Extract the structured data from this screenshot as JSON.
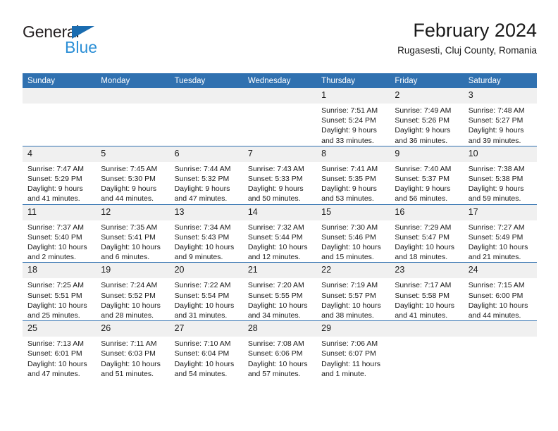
{
  "brand": {
    "name_dark": "General",
    "name_light": "Blue",
    "triangle_icon": "brand-triangle-icon"
  },
  "header": {
    "title": "February 2024",
    "location": "Rugasesti, Cluj County, Romania"
  },
  "colors": {
    "header_blue": "#3071B0",
    "brand_blue": "#2C8FD6",
    "daynum_band": "#F0F0F0",
    "text": "#1A1A1A"
  },
  "weekday_headers": [
    "Sunday",
    "Monday",
    "Tuesday",
    "Wednesday",
    "Thursday",
    "Friday",
    "Saturday"
  ],
  "weeks": [
    [
      {
        "day": "",
        "lines": []
      },
      {
        "day": "",
        "lines": []
      },
      {
        "day": "",
        "lines": []
      },
      {
        "day": "",
        "lines": []
      },
      {
        "day": "1",
        "lines": [
          "Sunrise: 7:51 AM",
          "Sunset: 5:24 PM",
          "Daylight: 9 hours",
          "and 33 minutes."
        ]
      },
      {
        "day": "2",
        "lines": [
          "Sunrise: 7:49 AM",
          "Sunset: 5:26 PM",
          "Daylight: 9 hours",
          "and 36 minutes."
        ]
      },
      {
        "day": "3",
        "lines": [
          "Sunrise: 7:48 AM",
          "Sunset: 5:27 PM",
          "Daylight: 9 hours",
          "and 39 minutes."
        ]
      }
    ],
    [
      {
        "day": "4",
        "lines": [
          "Sunrise: 7:47 AM",
          "Sunset: 5:29 PM",
          "Daylight: 9 hours",
          "and 41 minutes."
        ]
      },
      {
        "day": "5",
        "lines": [
          "Sunrise: 7:45 AM",
          "Sunset: 5:30 PM",
          "Daylight: 9 hours",
          "and 44 minutes."
        ]
      },
      {
        "day": "6",
        "lines": [
          "Sunrise: 7:44 AM",
          "Sunset: 5:32 PM",
          "Daylight: 9 hours",
          "and 47 minutes."
        ]
      },
      {
        "day": "7",
        "lines": [
          "Sunrise: 7:43 AM",
          "Sunset: 5:33 PM",
          "Daylight: 9 hours",
          "and 50 minutes."
        ]
      },
      {
        "day": "8",
        "lines": [
          "Sunrise: 7:41 AM",
          "Sunset: 5:35 PM",
          "Daylight: 9 hours",
          "and 53 minutes."
        ]
      },
      {
        "day": "9",
        "lines": [
          "Sunrise: 7:40 AM",
          "Sunset: 5:37 PM",
          "Daylight: 9 hours",
          "and 56 minutes."
        ]
      },
      {
        "day": "10",
        "lines": [
          "Sunrise: 7:38 AM",
          "Sunset: 5:38 PM",
          "Daylight: 9 hours",
          "and 59 minutes."
        ]
      }
    ],
    [
      {
        "day": "11",
        "lines": [
          "Sunrise: 7:37 AM",
          "Sunset: 5:40 PM",
          "Daylight: 10 hours",
          "and 2 minutes."
        ]
      },
      {
        "day": "12",
        "lines": [
          "Sunrise: 7:35 AM",
          "Sunset: 5:41 PM",
          "Daylight: 10 hours",
          "and 6 minutes."
        ]
      },
      {
        "day": "13",
        "lines": [
          "Sunrise: 7:34 AM",
          "Sunset: 5:43 PM",
          "Daylight: 10 hours",
          "and 9 minutes."
        ]
      },
      {
        "day": "14",
        "lines": [
          "Sunrise: 7:32 AM",
          "Sunset: 5:44 PM",
          "Daylight: 10 hours",
          "and 12 minutes."
        ]
      },
      {
        "day": "15",
        "lines": [
          "Sunrise: 7:30 AM",
          "Sunset: 5:46 PM",
          "Daylight: 10 hours",
          "and 15 minutes."
        ]
      },
      {
        "day": "16",
        "lines": [
          "Sunrise: 7:29 AM",
          "Sunset: 5:47 PM",
          "Daylight: 10 hours",
          "and 18 minutes."
        ]
      },
      {
        "day": "17",
        "lines": [
          "Sunrise: 7:27 AM",
          "Sunset: 5:49 PM",
          "Daylight: 10 hours",
          "and 21 minutes."
        ]
      }
    ],
    [
      {
        "day": "18",
        "lines": [
          "Sunrise: 7:25 AM",
          "Sunset: 5:51 PM",
          "Daylight: 10 hours",
          "and 25 minutes."
        ]
      },
      {
        "day": "19",
        "lines": [
          "Sunrise: 7:24 AM",
          "Sunset: 5:52 PM",
          "Daylight: 10 hours",
          "and 28 minutes."
        ]
      },
      {
        "day": "20",
        "lines": [
          "Sunrise: 7:22 AM",
          "Sunset: 5:54 PM",
          "Daylight: 10 hours",
          "and 31 minutes."
        ]
      },
      {
        "day": "21",
        "lines": [
          "Sunrise: 7:20 AM",
          "Sunset: 5:55 PM",
          "Daylight: 10 hours",
          "and 34 minutes."
        ]
      },
      {
        "day": "22",
        "lines": [
          "Sunrise: 7:19 AM",
          "Sunset: 5:57 PM",
          "Daylight: 10 hours",
          "and 38 minutes."
        ]
      },
      {
        "day": "23",
        "lines": [
          "Sunrise: 7:17 AM",
          "Sunset: 5:58 PM",
          "Daylight: 10 hours",
          "and 41 minutes."
        ]
      },
      {
        "day": "24",
        "lines": [
          "Sunrise: 7:15 AM",
          "Sunset: 6:00 PM",
          "Daylight: 10 hours",
          "and 44 minutes."
        ]
      }
    ],
    [
      {
        "day": "25",
        "lines": [
          "Sunrise: 7:13 AM",
          "Sunset: 6:01 PM",
          "Daylight: 10 hours",
          "and 47 minutes."
        ]
      },
      {
        "day": "26",
        "lines": [
          "Sunrise: 7:11 AM",
          "Sunset: 6:03 PM",
          "Daylight: 10 hours",
          "and 51 minutes."
        ]
      },
      {
        "day": "27",
        "lines": [
          "Sunrise: 7:10 AM",
          "Sunset: 6:04 PM",
          "Daylight: 10 hours",
          "and 54 minutes."
        ]
      },
      {
        "day": "28",
        "lines": [
          "Sunrise: 7:08 AM",
          "Sunset: 6:06 PM",
          "Daylight: 10 hours",
          "and 57 minutes."
        ]
      },
      {
        "day": "29",
        "lines": [
          "Sunrise: 7:06 AM",
          "Sunset: 6:07 PM",
          "Daylight: 11 hours",
          "and 1 minute."
        ]
      },
      {
        "day": "",
        "lines": []
      },
      {
        "day": "",
        "lines": []
      }
    ]
  ]
}
